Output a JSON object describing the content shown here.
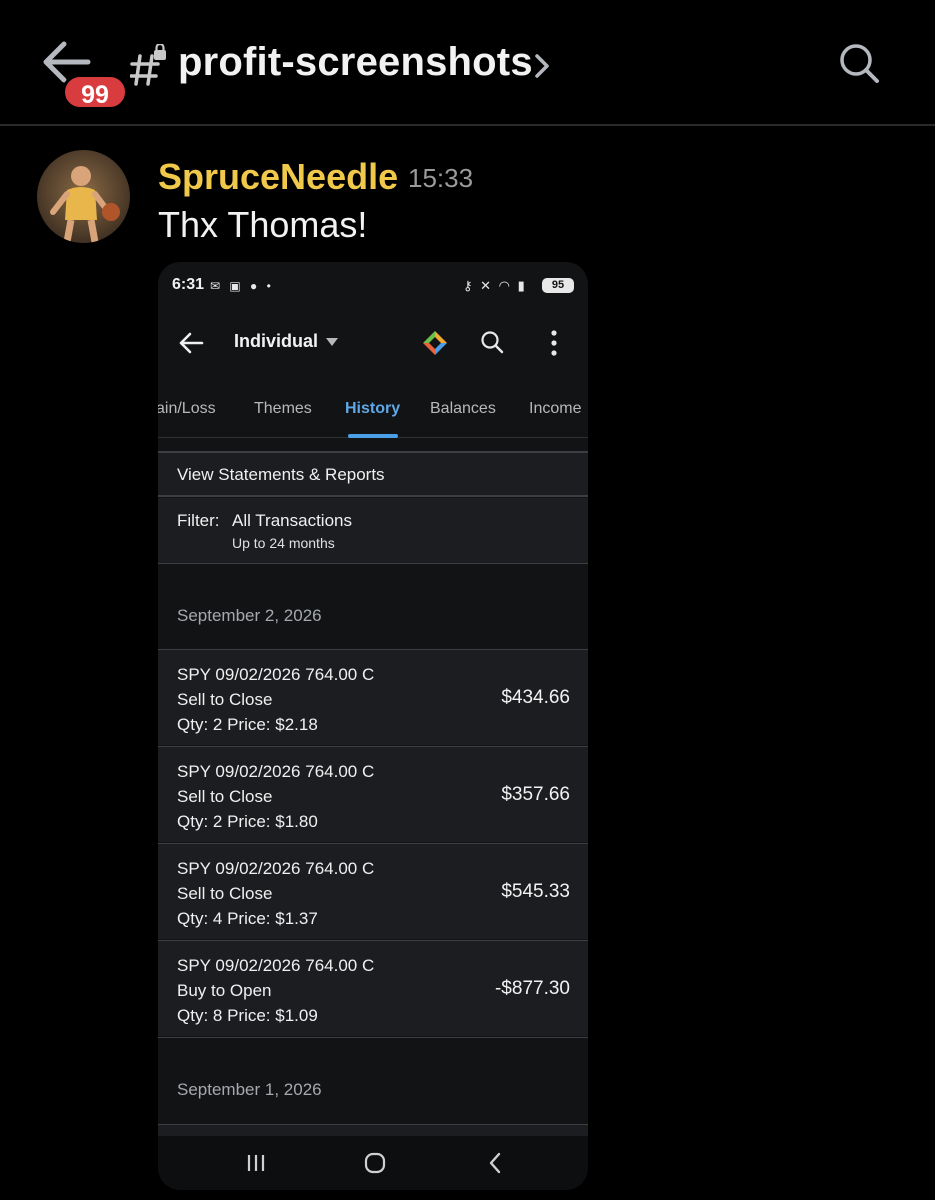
{
  "header": {
    "unread_badge": "99",
    "channel_name": "profit-screenshots"
  },
  "message": {
    "username": "SpruceNeedle",
    "timestamp": "15:33",
    "text": "Thx Thomas!"
  },
  "phone": {
    "status_bar": {
      "time": "6:31",
      "battery": "95"
    },
    "app_bar": {
      "account": "Individual"
    },
    "tabs": [
      {
        "label": "ain/Loss",
        "active": false
      },
      {
        "label": "Themes",
        "active": false
      },
      {
        "label": "History",
        "active": true
      },
      {
        "label": "Balances",
        "active": false
      },
      {
        "label": "Income",
        "active": false
      }
    ],
    "reports_link": "View Statements & Reports",
    "filter": {
      "label": "Filter:",
      "value": "All Transactions",
      "range": "Up to 24 months"
    },
    "date_groups": [
      {
        "date": "September 2, 2026",
        "transactions": [
          {
            "symbol": "SPY 09/02/2026 764.00 C",
            "action": "Sell to Close",
            "details": "Qty: 2  Price: $2.18",
            "amount": "$434.66"
          },
          {
            "symbol": "SPY 09/02/2026 764.00 C",
            "action": "Sell to Close",
            "details": "Qty: 2  Price: $1.80",
            "amount": "$357.66"
          },
          {
            "symbol": "SPY 09/02/2026 764.00 C",
            "action": "Sell to Close",
            "details": "Qty: 4  Price: $1.37",
            "amount": "$545.33"
          },
          {
            "symbol": "SPY 09/02/2026 764.00 C",
            "action": "Buy to Open",
            "details": "Qty: 8  Price: $1.09",
            "amount": "-$877.30"
          }
        ]
      },
      {
        "date": "September 1, 2026",
        "transactions": []
      }
    ]
  },
  "colors": {
    "username": "#f0c94a",
    "active_tab": "#5fa7e6",
    "badge": "#d83c3e"
  }
}
